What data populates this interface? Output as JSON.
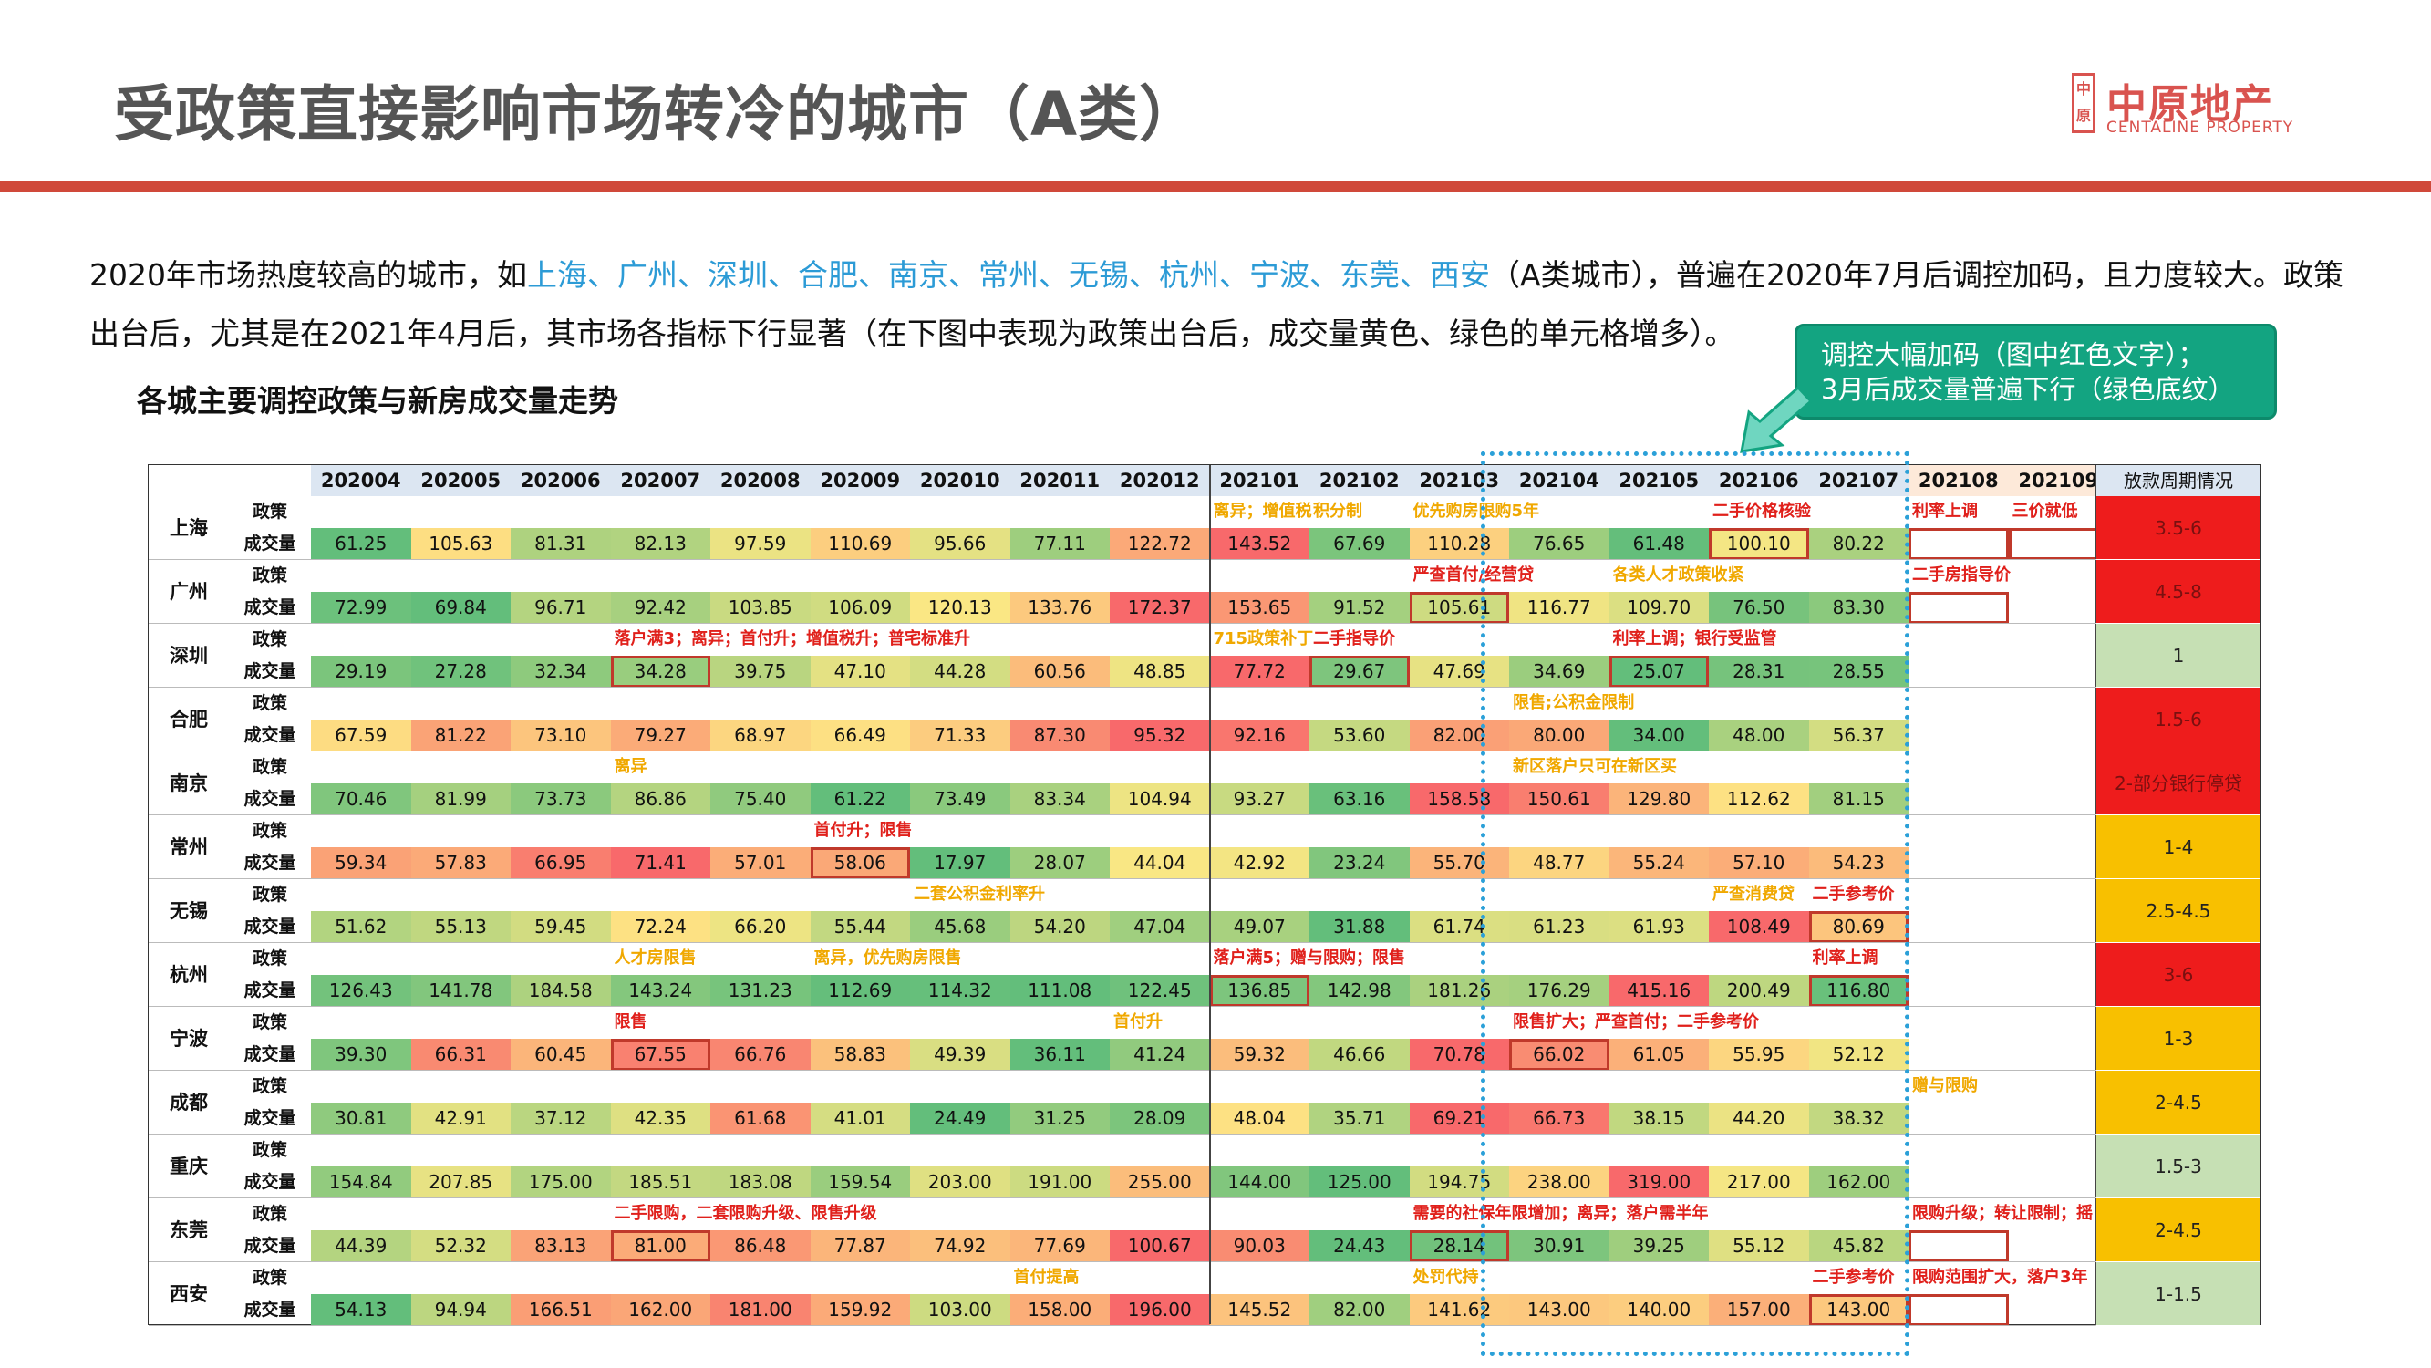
{
  "title": "受政策直接影响市场转冷的城市（A类）",
  "logo": {
    "seal": "中原",
    "name": "中原地产",
    "en": "CENTALINE PROPERTY"
  },
  "paragraph": {
    "p1": "2020年市场热度较高的城市，如",
    "cities": "上海、广州、深圳、合肥、南京、常州、无锡、杭州、宁波、东莞、西安",
    "p2": "（A类城市），普遍在2020年7月后调控加码，且力度较大。政策出台后，尤其是在2021年4月后，其市场各指标下行显著（在下图中表现为政策出台后，成交量黄色、绿色的单元格增多）。"
  },
  "subtitle": "各城主要调控政策与新房成交量走势",
  "callout": {
    "line1": "调控大幅加码（图中红色文字）；",
    "line2": "3月后成交量普遍下行（绿色底纹）"
  },
  "table": {
    "months": [
      "202004",
      "202005",
      "202006",
      "202007",
      "202008",
      "202009",
      "202010",
      "202011",
      "202012",
      "202101",
      "202102",
      "202103",
      "202104",
      "202105",
      "202106",
      "202107",
      "202108",
      "202109"
    ],
    "period_header": "放款周期情况",
    "row_policy_label": "政策",
    "row_volume_label": "成交量",
    "rows": [
      {
        "city": "上海",
        "values": [
          "61.25",
          "105.63",
          "81.31",
          "82.13",
          "97.59",
          "110.69",
          "95.66",
          "77.11",
          "122.72",
          "143.52",
          "67.69",
          "110.28",
          "76.65",
          "61.48",
          "100.10",
          "80.22"
        ],
        "period": "3.5-6",
        "policies": [
          {
            "col": 9,
            "text": "离异；增值税",
            "c": "y"
          },
          {
            "col": 10,
            "text": "积分制",
            "c": "y"
          },
          {
            "col": 11,
            "text": "优先购房限购5年",
            "c": "y"
          },
          {
            "col": 14,
            "text": "二手价格核验",
            "c": "r"
          },
          {
            "col": 16,
            "text": "利率上调",
            "c": "r"
          },
          {
            "col": 17,
            "text": "三价就低",
            "c": "r"
          }
        ]
      },
      {
        "city": "广州",
        "values": [
          "72.99",
          "69.84",
          "96.71",
          "92.42",
          "103.85",
          "106.09",
          "120.13",
          "133.76",
          "172.37",
          "153.65",
          "91.52",
          "105.61",
          "116.77",
          "109.70",
          "76.50",
          "83.30"
        ],
        "period": "4.5-8",
        "policies": [
          {
            "col": 11,
            "text": "严查首付/经营贷",
            "c": "r"
          },
          {
            "col": 13,
            "text": "各类人才政策收紧",
            "c": "y"
          },
          {
            "col": 16,
            "text": "二手房指导价",
            "c": "r"
          }
        ]
      },
      {
        "city": "深圳",
        "values": [
          "29.19",
          "27.28",
          "32.34",
          "34.28",
          "39.75",
          "47.10",
          "44.28",
          "60.56",
          "48.85",
          "77.72",
          "29.67",
          "47.69",
          "34.69",
          "25.07",
          "28.31",
          "28.55"
        ],
        "period": "1",
        "policies": [
          {
            "col": 3,
            "text": "落户满3；离异；首付升；增值税升；普宅标准升",
            "c": "r"
          },
          {
            "col": 9,
            "text": "715政策补丁",
            "c": "y"
          },
          {
            "col": 10,
            "text": "二手指导价",
            "c": "r"
          },
          {
            "col": 13,
            "text": "利率上调；银行受监管",
            "c": "r"
          }
        ]
      },
      {
        "city": "合肥",
        "values": [
          "67.59",
          "81.22",
          "73.10",
          "79.27",
          "68.97",
          "66.49",
          "71.33",
          "87.30",
          "95.32",
          "92.16",
          "53.60",
          "82.00",
          "80.00",
          "34.00",
          "48.00",
          "56.37"
        ],
        "period": "1.5-6",
        "policies": [
          {
            "col": 12,
            "text": "限售;公积金限制",
            "c": "y"
          }
        ]
      },
      {
        "city": "南京",
        "values": [
          "70.46",
          "81.99",
          "73.73",
          "86.86",
          "75.40",
          "61.22",
          "73.49",
          "83.34",
          "104.94",
          "93.27",
          "63.16",
          "158.58",
          "150.61",
          "129.80",
          "112.62",
          "81.15"
        ],
        "period": "2-部分银行停贷",
        "policies": [
          {
            "col": 3,
            "text": "离异",
            "c": "y"
          },
          {
            "col": 12,
            "text": "新区落户只可在新区买",
            "c": "y"
          }
        ]
      },
      {
        "city": "常州",
        "values": [
          "59.34",
          "57.83",
          "66.95",
          "71.41",
          "57.01",
          "58.06",
          "17.97",
          "28.07",
          "44.04",
          "42.92",
          "23.24",
          "55.70",
          "48.77",
          "55.24",
          "57.10",
          "54.23"
        ],
        "period": "1-4",
        "policies": [
          {
            "col": 5,
            "text": "首付升；限售",
            "c": "r"
          }
        ]
      },
      {
        "city": "无锡",
        "values": [
          "51.62",
          "55.13",
          "59.45",
          "72.24",
          "66.20",
          "55.44",
          "45.68",
          "54.20",
          "47.04",
          "49.07",
          "31.88",
          "61.74",
          "61.23",
          "61.93",
          "108.49",
          "80.69"
        ],
        "period": "2.5-4.5",
        "policies": [
          {
            "col": 6,
            "text": "二套公积金利率升",
            "c": "y"
          },
          {
            "col": 14,
            "text": "严查消费贷",
            "c": "y"
          },
          {
            "col": 15,
            "text": "二手参考价",
            "c": "r"
          }
        ]
      },
      {
        "city": "杭州",
        "values": [
          "126.43",
          "141.78",
          "184.58",
          "143.24",
          "131.23",
          "112.69",
          "114.32",
          "111.08",
          "122.45",
          "136.85",
          "142.98",
          "181.26",
          "176.29",
          "415.16",
          "200.49",
          "116.80"
        ],
        "period": "3-6",
        "policies": [
          {
            "col": 3,
            "text": "人才房限售",
            "c": "y"
          },
          {
            "col": 5,
            "text": "离异，优先购房限售",
            "c": "y"
          },
          {
            "col": 9,
            "text": "落户满5；赠与限购；限售",
            "c": "r"
          },
          {
            "col": 15,
            "text": "利率上调",
            "c": "r"
          }
        ]
      },
      {
        "city": "宁波",
        "values": [
          "39.30",
          "66.31",
          "60.45",
          "67.55",
          "66.76",
          "58.83",
          "49.39",
          "36.11",
          "41.24",
          "59.32",
          "46.66",
          "70.78",
          "66.02",
          "61.05",
          "55.95",
          "52.12"
        ],
        "period": "1-3",
        "policies": [
          {
            "col": 3,
            "text": "限售",
            "c": "r"
          },
          {
            "col": 8,
            "text": "首付升",
            "c": "y"
          },
          {
            "col": 12,
            "text": "限售扩大；严查首付；二手参考价",
            "c": "r"
          }
        ]
      },
      {
        "city": "成都",
        "values": [
          "30.81",
          "42.91",
          "37.12",
          "42.35",
          "61.68",
          "41.01",
          "24.49",
          "31.25",
          "28.09",
          "48.04",
          "35.71",
          "69.21",
          "66.73",
          "38.15",
          "44.20",
          "38.32"
        ],
        "period": "2-4.5",
        "policies": [
          {
            "col": 16,
            "text": "赠与限购",
            "c": "y"
          }
        ]
      },
      {
        "city": "重庆",
        "values": [
          "154.84",
          "207.85",
          "175.00",
          "185.51",
          "183.08",
          "159.54",
          "203.00",
          "191.00",
          "255.00",
          "144.00",
          "125.00",
          "194.75",
          "238.00",
          "319.00",
          "217.00",
          "162.00"
        ],
        "period": "1.5-3",
        "policies": []
      },
      {
        "city": "东莞",
        "values": [
          "44.39",
          "52.32",
          "83.13",
          "81.00",
          "86.48",
          "77.87",
          "74.92",
          "77.69",
          "100.67",
          "90.03",
          "24.43",
          "28.14",
          "30.91",
          "39.25",
          "55.12",
          "45.82"
        ],
        "period": "2-4.5",
        "policies": [
          {
            "col": 3,
            "text": "二手限购，二套限购升级、限售升级",
            "c": "r"
          },
          {
            "col": 11,
            "text": "需要的社保年限增加；离异；落户需半年",
            "c": "r"
          },
          {
            "col": 16,
            "text": "限购升级；转让限制；摇号",
            "c": "r"
          }
        ]
      },
      {
        "city": "西安",
        "values": [
          "54.13",
          "94.94",
          "166.51",
          "162.00",
          "181.00",
          "159.92",
          "103.00",
          "158.00",
          "196.00",
          "145.52",
          "82.00",
          "141.62",
          "143.00",
          "140.00",
          "157.00",
          "143.00"
        ],
        "period": "1-1.5",
        "policies": [
          {
            "col": 7,
            "text": "首付提高",
            "c": "y"
          },
          {
            "col": 11,
            "text": "处罚代持",
            "c": "y"
          },
          {
            "col": 15,
            "text": "二手参考价",
            "c": "r"
          },
          {
            "col": 16,
            "text": "限购范围扩大，落户3年",
            "c": "r"
          }
        ]
      }
    ]
  },
  "colors": {
    "heat_low": "#63be7b",
    "heat_mid": "#fde884",
    "heat_high": "#f8696b",
    "period_red": "#ee1c1c",
    "period_orange": "#f8c000",
    "period_green": "#c6e0b4",
    "accent_red": "#d0493a",
    "callout_green": "#13a481",
    "highlight_blue": "#2c9bd6"
  }
}
